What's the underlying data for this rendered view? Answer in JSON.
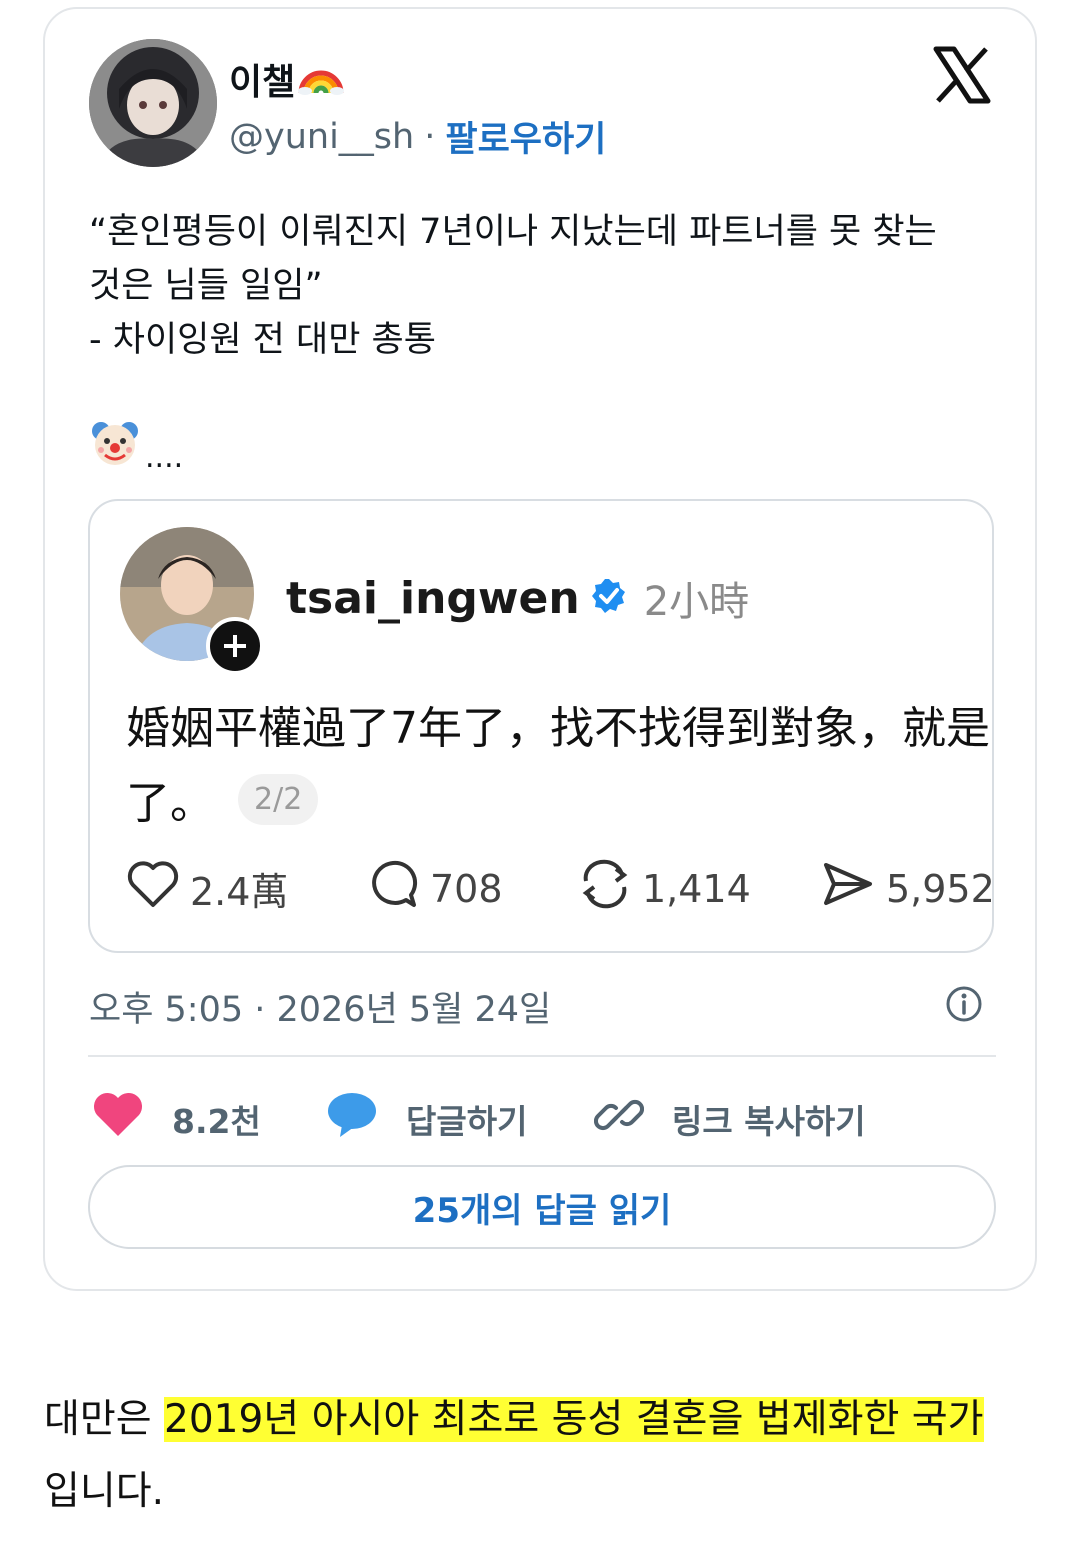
{
  "tweet": {
    "display_name": "이챌",
    "handle": "@yuni__sh",
    "separator": "·",
    "follow_label": "팔로우하기",
    "text": "“혼인평등이 이뤄진지 7년이나 지났는데 파트너를 못 찾는\n것은 님들 일임”\n- 차이잉원 전 대만 총통",
    "clown_suffix": "....",
    "timestamp": "오후 5:05 · 2026년 5월 24일",
    "like_count": "8.2천",
    "reply_label": "답글하기",
    "copy_link_label": "링크 복사하기",
    "read_replies_label": "25개의 답글 읽기",
    "icons": [
      "rainbow-icon",
      "x-logo-icon",
      "clown-face-icon",
      "info-icon",
      "heart-icon",
      "speech-bubble-icon",
      "link-icon"
    ]
  },
  "embedded_post": {
    "username": "tsai_ingwen",
    "time": "2小時",
    "text_line1": "婚姻平權過了7年了，找不找得到對象，就是",
    "text_line2": "了。",
    "page_indicator": "2/2",
    "likes": "2.4萬",
    "comments": "708",
    "reposts": "1,414",
    "shares": "5,952",
    "icons": [
      "verified-badge-icon",
      "plus-icon",
      "heart-outline-icon",
      "comment-icon",
      "repost-icon",
      "share-icon"
    ]
  },
  "caption": {
    "before": "대만은 ",
    "highlight": "2019년 아시아 최초로 동성 결혼을 법제화한 국가",
    "after": "입니다."
  },
  "colors": {
    "accent_blue": "#1d6fc2",
    "heart_pink": "#f0457e",
    "bubble_blue": "#3d9be9",
    "highlight_yellow": "#ffff33",
    "verified_blue": "#1f8ef1"
  }
}
